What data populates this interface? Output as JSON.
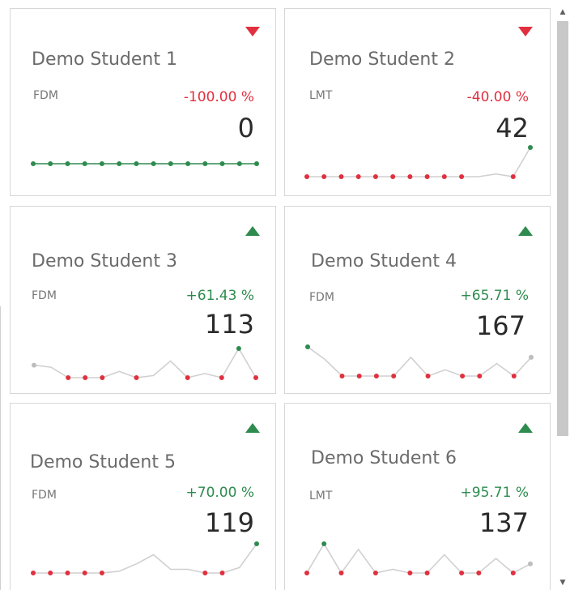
{
  "colors": {
    "up": "#2e8b4e",
    "down": "#e0303e",
    "neutral_line": "#d0d0d0",
    "neutral_point": "#bdbdbd"
  },
  "icons": {
    "up": "triangle-up-icon",
    "down": "triangle-down-icon",
    "scroll_up": "▲",
    "scroll_down": "▼"
  },
  "cards": [
    {
      "name": "Demo Student 1",
      "code": "FDM",
      "change": "-100.00 %",
      "trend": "down",
      "value": "0",
      "sparkline": [
        0,
        0,
        0,
        0,
        0,
        0,
        0,
        0,
        0,
        0,
        0,
        0,
        0,
        0
      ],
      "point_colors": [
        "up",
        "up",
        "up",
        "up",
        "up",
        "up",
        "up",
        "up",
        "up",
        "up",
        "up",
        "up",
        "up",
        "up"
      ]
    },
    {
      "name": "Demo Student 2",
      "code": "LMT",
      "change": "-40.00 %",
      "trend": "down",
      "value": "42",
      "sparkline": [
        0,
        0,
        0,
        0,
        0,
        0,
        0,
        0,
        0,
        0,
        0,
        1,
        0,
        11
      ],
      "point_colors": [
        "down",
        "down",
        "down",
        "down",
        "down",
        "down",
        "down",
        "down",
        "down",
        "down",
        null,
        null,
        "down",
        "up"
      ]
    },
    {
      "name": "Demo Student 3",
      "code": "FDM",
      "change": "+61.43 %",
      "trend": "up",
      "value": "113",
      "sparkline": [
        6,
        5,
        0,
        0,
        0,
        3,
        0,
        1,
        8,
        0,
        2,
        0,
        14,
        0
      ],
      "point_colors": [
        "neutral",
        null,
        "down",
        "down",
        "down",
        null,
        "down",
        null,
        null,
        "down",
        null,
        "down",
        "up",
        "down"
      ]
    },
    {
      "name": "Demo Student 4",
      "code": "FDM",
      "change": "+65.71 %",
      "trend": "up",
      "value": "167",
      "sparkline": [
        14,
        8,
        0,
        0,
        0,
        0,
        9,
        0,
        3,
        0,
        0,
        6,
        0,
        9
      ],
      "point_colors": [
        "up",
        null,
        "down",
        "down",
        "down",
        "down",
        null,
        "down",
        null,
        "down",
        "down",
        null,
        "down",
        "neutral"
      ]
    },
    {
      "name": "Demo Student 5",
      "code": "FDM",
      "change": "+70.00 %",
      "trend": "up",
      "value": "119",
      "sparkline": [
        0,
        0,
        0,
        0,
        0,
        1,
        5,
        10,
        2,
        2,
        0,
        0,
        3,
        16
      ],
      "point_colors": [
        "down",
        "down",
        "down",
        "down",
        "down",
        null,
        null,
        null,
        null,
        null,
        "down",
        "down",
        null,
        "up"
      ]
    },
    {
      "name": "Demo Student 6",
      "code": "LMT",
      "change": "+95.71 %",
      "trend": "up",
      "value": "137",
      "sparkline": [
        0,
        16,
        0,
        13,
        0,
        2,
        0,
        0,
        10,
        0,
        0,
        8,
        0,
        5
      ],
      "point_colors": [
        "down",
        "up",
        "down",
        null,
        "down",
        null,
        "down",
        "down",
        null,
        "down",
        "down",
        null,
        "down",
        "neutral"
      ]
    }
  ]
}
